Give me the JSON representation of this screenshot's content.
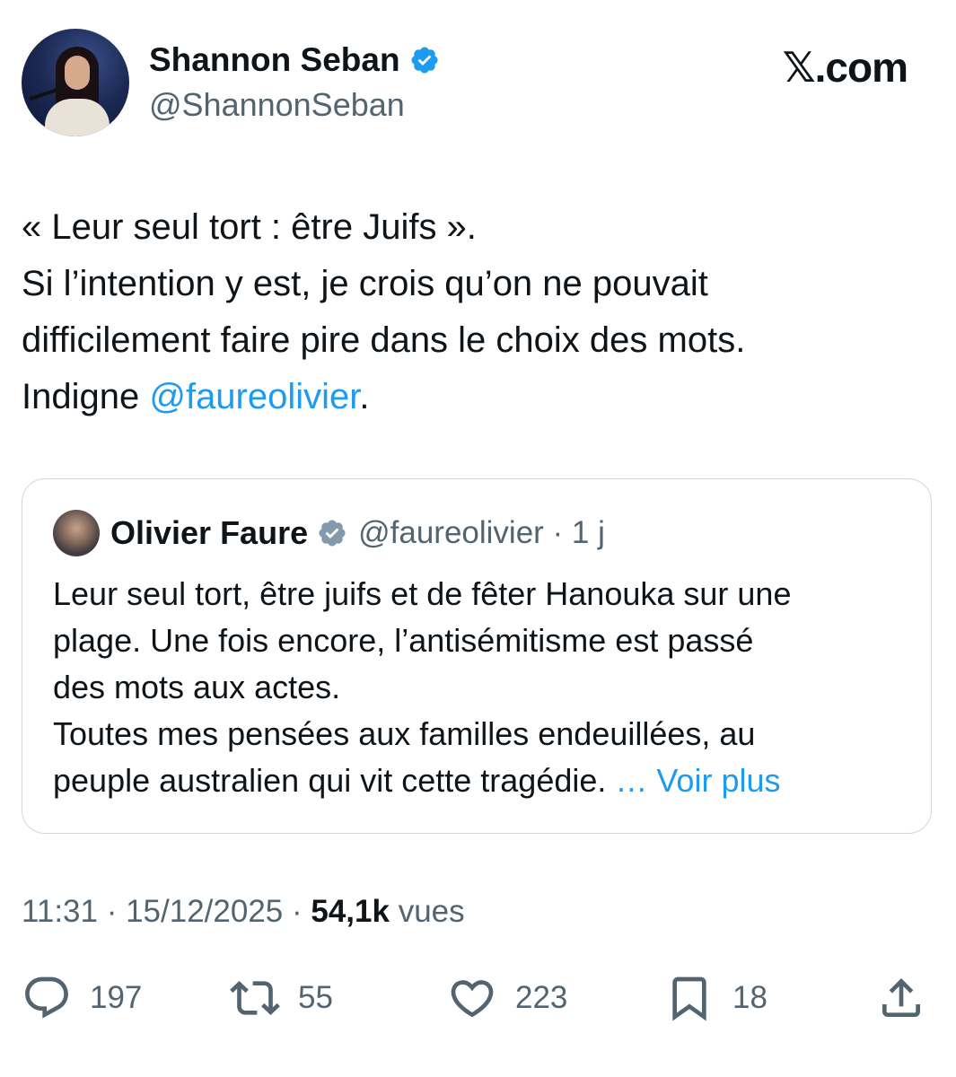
{
  "author": {
    "display_name": "Shannon Seban",
    "handle": "@ShannonSeban",
    "verified": true
  },
  "brand": {
    "logo_text": "𝕏.com"
  },
  "tweet": {
    "lines": [
      "« Leur seul tort : être Juifs ».",
      "Si l’intention y est, je crois qu’on ne pouvait",
      "difficilement faire pire dans le choix des mots."
    ],
    "last_line_prefix": "Indigne ",
    "mention": "@faureolivier",
    "last_line_suffix": "."
  },
  "quoted": {
    "display_name": "Olivier Faure",
    "verified": true,
    "handle_time": "@faureolivier · 1 j",
    "lines": [
      "Leur seul tort, être juifs et de fêter Hanouka sur une",
      "plage. Une fois encore, l’antisémitisme est passé",
      "des mots aux actes.",
      "Toutes mes pensées aux familles endeuillées, au"
    ],
    "last_line": "peuple australien qui vit cette tragédie. ",
    "see_more": "… Voir plus"
  },
  "meta": {
    "time_date": "11:31 · 15/12/2025 · ",
    "views_count": "54,1k",
    "views_label": " vues"
  },
  "actions": {
    "replies": "197",
    "reposts": "55",
    "likes": "223",
    "bookmarks": "18"
  },
  "colors": {
    "accent": "#1d9bf0",
    "text_primary": "#0f1419",
    "text_secondary": "#536471",
    "border": "#cfd9de"
  }
}
